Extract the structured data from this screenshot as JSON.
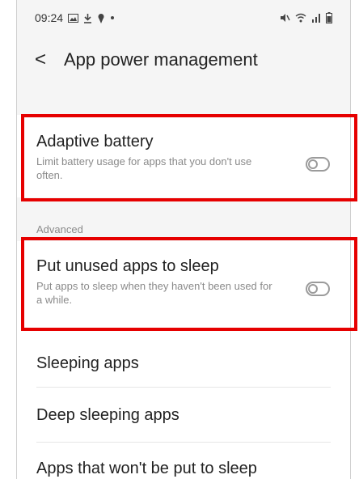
{
  "status_bar": {
    "time": "09:24",
    "icons_left": [
      "gallery-icon",
      "download-icon",
      "location-pin-icon",
      "dot-icon"
    ],
    "icons_right": [
      "mute-icon",
      "wifi-icon",
      "signal-icon",
      "battery-icon"
    ]
  },
  "header": {
    "back_glyph": "<",
    "title": "App power management"
  },
  "adaptive_battery": {
    "title": "Adaptive battery",
    "description": "Limit battery usage for apps that you don't use often.",
    "enabled": false
  },
  "advanced_section": {
    "label": "Advanced"
  },
  "put_unused_apps_to_sleep": {
    "title": "Put unused apps to sleep",
    "description": "Put apps to sleep when they haven't been used for a while.",
    "enabled": false
  },
  "list_items": [
    {
      "label": "Sleeping apps"
    },
    {
      "label": "Deep sleeping apps"
    },
    {
      "label": "Apps that won't be put to sleep"
    }
  ],
  "colors": {
    "highlight": "#e60000",
    "background": "#f5f5f5",
    "card": "#ffffff"
  }
}
